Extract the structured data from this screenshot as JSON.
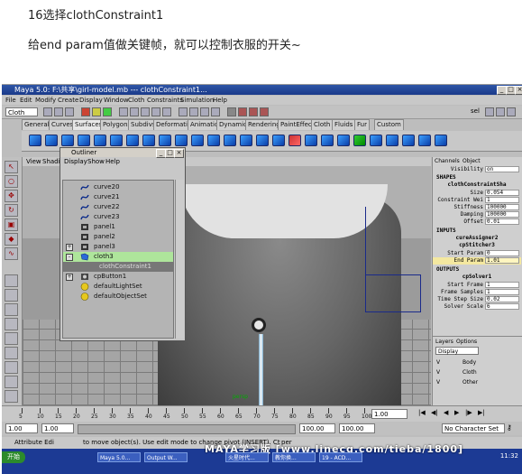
{
  "heading": "16选择clothConstraint1",
  "description": "给end param值做关键帧，就可以控制衣服的开关~",
  "window": {
    "title": "Maya 5.0: F:\\共享\\girl-model.mb  ---  clothConstraint1..."
  },
  "menubar": [
    "File",
    "Edit",
    "Modify",
    "Create",
    "Display",
    "Window",
    "Cloth",
    "Constraints",
    "Simulation",
    "Help"
  ],
  "mode_dropdown": "Cloth",
  "sel_label": "sel",
  "shelf_tabs": [
    "General",
    "Curves",
    "Surfaces",
    "Polygons",
    "Subdivs",
    "Deformation",
    "Animation",
    "Dynamics",
    "Rendering",
    "PaintEffects",
    "Cloth",
    "Fluids",
    "Fur",
    "Custom"
  ],
  "active_shelf_tab": "Surfaces",
  "viewport": {
    "menu": [
      "View",
      "Shadi"
    ],
    "camera_label": "persp"
  },
  "outliner": {
    "title": "Outliner",
    "menu": [
      "Display",
      "Show",
      "Help"
    ],
    "items": [
      {
        "label": "curve20",
        "icon": "curve-icon",
        "expand": ""
      },
      {
        "label": "curve21",
        "icon": "curve-icon",
        "expand": ""
      },
      {
        "label": "curve22",
        "icon": "curve-icon",
        "expand": ""
      },
      {
        "label": "curve23",
        "icon": "curve-icon",
        "expand": ""
      },
      {
        "label": "panel1",
        "icon": "panel-icon",
        "expand": ""
      },
      {
        "label": "panel2",
        "icon": "panel-icon",
        "expand": ""
      },
      {
        "label": "panel3",
        "icon": "panel-icon",
        "expand": "+"
      },
      {
        "label": "cloth3",
        "icon": "cloth-icon",
        "expand": "-",
        "state": "selected"
      },
      {
        "label": "clothConstraint1",
        "icon": "",
        "expand": "",
        "state": "child"
      },
      {
        "label": "cpButton1",
        "icon": "button-icon",
        "expand": "+"
      },
      {
        "label": "defaultLightSet",
        "icon": "set-icon",
        "expand": ""
      },
      {
        "label": "defaultObjectSet",
        "icon": "set-icon",
        "expand": ""
      }
    ]
  },
  "channel_box": {
    "tabs": [
      "Channels",
      "Object"
    ],
    "top_attr": {
      "label": "Visibility",
      "value": "on"
    },
    "shapes_header": "SHAPES",
    "shape_node": "clothConstraintSha",
    "shape_attrs": [
      {
        "label": "Size",
        "value": "0.054"
      },
      {
        "label": "Constraint Wei",
        "value": "1"
      },
      {
        "label": "Stiffness",
        "value": "100000"
      },
      {
        "label": "Damping",
        "value": "100000"
      },
      {
        "label": "Offset",
        "value": "0.01"
      }
    ],
    "inputs_header": "INPUTS",
    "input_nodes": [
      "cureAssigner2",
      "cpStitcher3"
    ],
    "input_attrs": [
      {
        "label": "Start Param",
        "value": "0"
      },
      {
        "label": "End Param",
        "value": "1.01"
      }
    ],
    "outputs_header": "OUTPUTS",
    "output_node": "cpSolver1",
    "output_attrs": [
      {
        "label": "Start Frame",
        "value": "1"
      },
      {
        "label": "Frame Samples",
        "value": "1"
      },
      {
        "label": "Time Step Size",
        "value": "0.02"
      },
      {
        "label": "Solver Scale",
        "value": "6"
      }
    ]
  },
  "layers": {
    "tabs": [
      "Layers",
      "Options"
    ],
    "dropdown": "Display",
    "rows": [
      {
        "v": "V",
        "name": "Body"
      },
      {
        "v": "V",
        "name": "Cloth"
      },
      {
        "v": "V",
        "name": "Other"
      }
    ]
  },
  "timeline": {
    "ticks": [
      "5",
      "10",
      "15",
      "20",
      "25",
      "30",
      "35",
      "40",
      "45",
      "50",
      "55",
      "60",
      "65",
      "70",
      "75",
      "80",
      "85",
      "90",
      "95",
      "100"
    ],
    "current_frame": "1.00"
  },
  "range": {
    "start": "1.00",
    "start_inner": "1.00",
    "end_inner": "100.00",
    "end": "100.00",
    "character_set": "No Character Set"
  },
  "command_line": {
    "label": "Attribute Edi",
    "message": "to move object(s). Use edit mode to change pivot (INSERT). Ct",
    "extra": "per"
  },
  "watermark": "MAYA学习版 [www.linecg.com/tieba/1800]",
  "taskbar": {
    "start": "开始",
    "items": [
      "Maya 5.0...",
      "Output W...",
      "火星时代...",
      "教你换...",
      "19 - ACD..."
    ],
    "clock": "11:32"
  }
}
